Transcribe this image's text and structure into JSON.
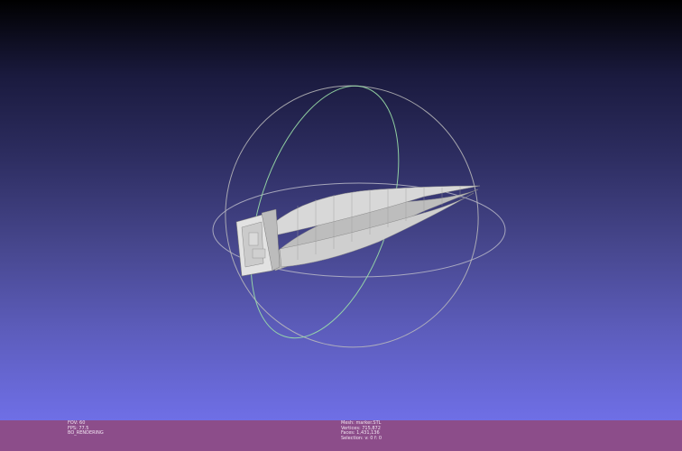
{
  "viewer": {
    "info_left": {
      "fov": "FOV: 60",
      "fps": "FPS:   77.5",
      "render_mode": "BO_RENDERING"
    },
    "info_right": {
      "mesh": "Mesh: marker.STL",
      "vertices": "Vertices: 715,872",
      "faces": "Faces: 1,431,136",
      "selection": "Selection: v: 0 f: 0"
    }
  },
  "colors": {
    "status_bar": "#8c4d8a",
    "mesh": "#d8d8d8",
    "trackball": "#c8c8c8"
  },
  "icons": [
    "trackball-gizmo"
  ]
}
